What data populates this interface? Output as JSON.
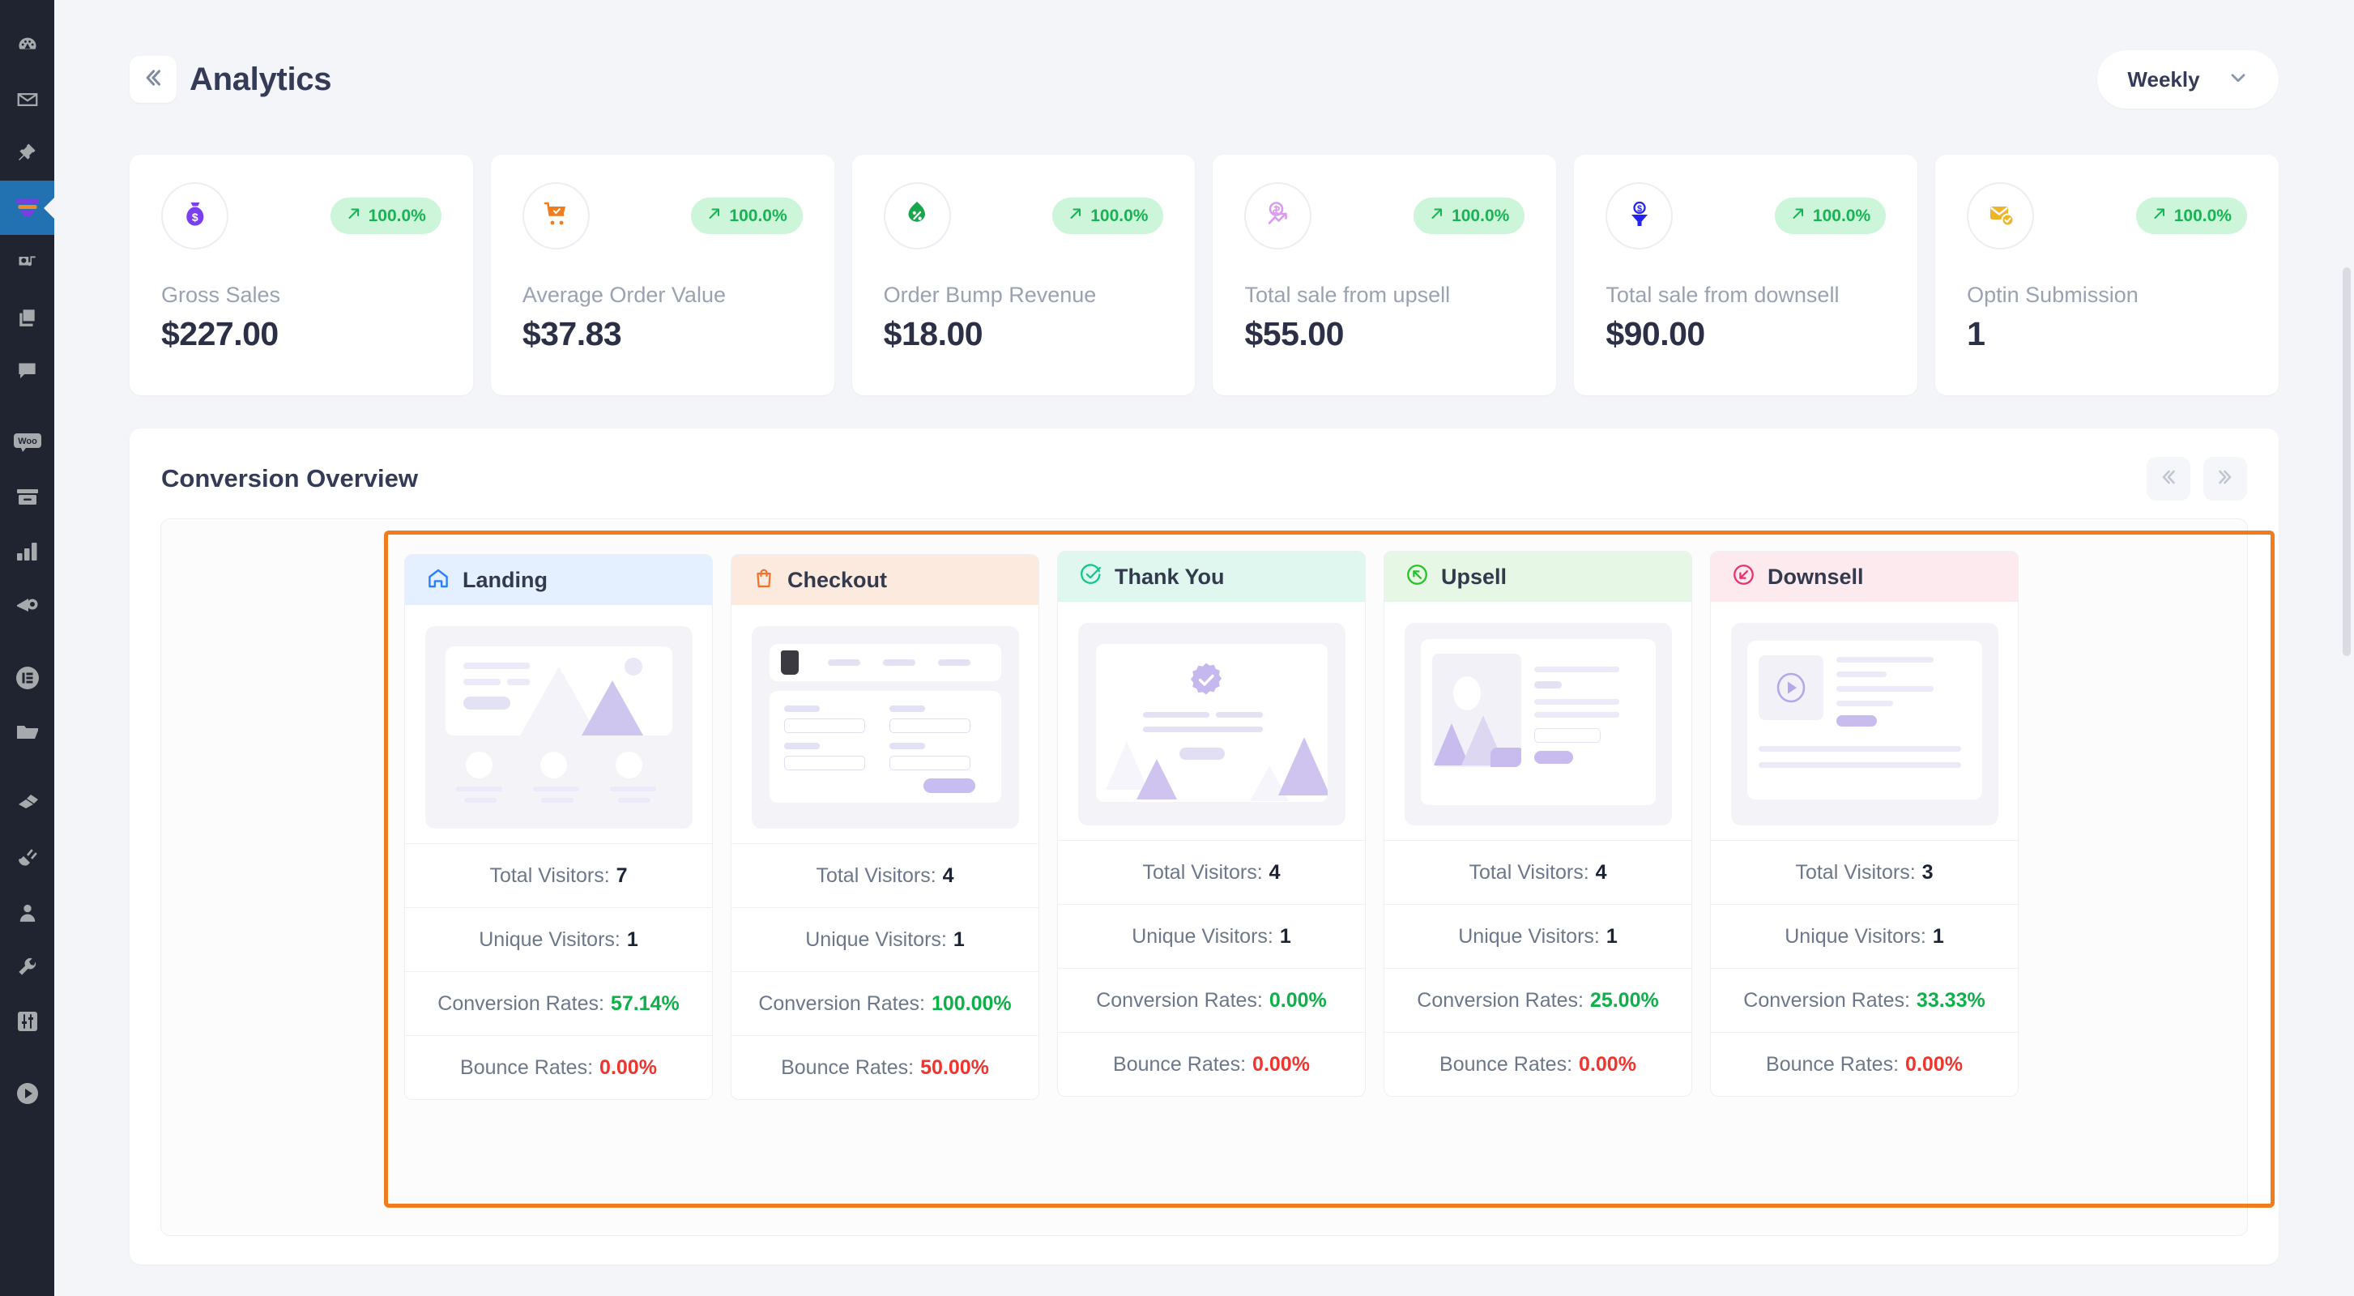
{
  "sidebar": {
    "items": [
      {
        "name": "dashboard",
        "icon": "gauge-icon"
      },
      {
        "name": "mail",
        "icon": "envelope-icon"
      },
      {
        "name": "pin",
        "icon": "pushpin-icon"
      },
      {
        "name": "funnel",
        "icon": "funnel-icon",
        "active": true
      },
      {
        "name": "media",
        "icon": "media-icon"
      },
      {
        "name": "pages",
        "icon": "pages-icon"
      },
      {
        "name": "comments",
        "icon": "comment-icon"
      },
      {
        "name": "woocommerce",
        "icon": "woo-icon"
      },
      {
        "name": "products",
        "icon": "archive-icon"
      },
      {
        "name": "analytics",
        "icon": "bar-chart-icon"
      },
      {
        "name": "marketing",
        "icon": "megaphone-icon"
      },
      {
        "name": "elementor",
        "icon": "elementor-icon"
      },
      {
        "name": "templates",
        "icon": "folder-icon"
      },
      {
        "name": "appearance",
        "icon": "paintbrush-icon"
      },
      {
        "name": "plugins",
        "icon": "plug-icon"
      },
      {
        "name": "users",
        "icon": "user-icon"
      },
      {
        "name": "tools",
        "icon": "wrench-icon"
      },
      {
        "name": "settings",
        "icon": "sliders-icon"
      },
      {
        "name": "player",
        "icon": "play-circle-icon"
      }
    ]
  },
  "header": {
    "title": "Analytics",
    "collapse_icon": "chevron-double-left-icon",
    "period": {
      "label": "Weekly",
      "chevron_icon": "chevron-down-icon"
    }
  },
  "kpis": [
    {
      "label": "Gross Sales",
      "value": "$227.00",
      "change": "100.0%",
      "trend_icon": "arrow-up-right-icon",
      "icon": "money-bag-icon",
      "icon_color": "#7b3ff2"
    },
    {
      "label": "Average Order Value",
      "value": "$37.83",
      "change": "100.0%",
      "trend_icon": "arrow-up-right-icon",
      "icon": "shopping-cart-icon",
      "icon_color": "#f07c1d"
    },
    {
      "label": "Order Bump Revenue",
      "value": "$18.00",
      "change": "100.0%",
      "trend_icon": "arrow-up-right-icon",
      "icon": "discount-leaf-icon",
      "icon_color": "#17a74a"
    },
    {
      "label": "Total sale from upsell",
      "value": "$55.00",
      "change": "100.0%",
      "trend_icon": "arrow-up-right-icon",
      "icon": "revenue-growth-icon",
      "icon_color": "#d99af0"
    },
    {
      "label": "Total sale from downsell",
      "value": "$90.00",
      "change": "100.0%",
      "trend_icon": "arrow-up-right-icon",
      "icon": "sales-funnel-icon",
      "icon_color": "#2323f5"
    },
    {
      "label": "Optin Submission",
      "value": "1",
      "change": "100.0%",
      "trend_icon": "arrow-up-right-icon",
      "icon": "mail-check-icon",
      "icon_color": "#f0b429"
    }
  ],
  "conversion": {
    "title": "Conversion Overview",
    "nav": {
      "prev_icon": "chevron-double-left-icon",
      "next_icon": "chevron-double-right-icon"
    },
    "stat_labels": {
      "total": "Total Visitors:",
      "unique": "Unique Visitors:",
      "conversion": "Conversion Rates:",
      "bounce": "Bounce Rates:"
    },
    "steps": [
      {
        "name": "Landing",
        "icon": "home-icon",
        "icon_color": "#2b7fff",
        "header_bg": "#e4efff",
        "thumb": "landing-page-wireframe",
        "total_visitors": "7",
        "unique_visitors": "1",
        "conversion_rate": "57.14%",
        "bounce_rate": "0.00%"
      },
      {
        "name": "Checkout",
        "icon": "shopping-bag-icon",
        "icon_color": "#f4712c",
        "header_bg": "#fdeade",
        "thumb": "checkout-form-wireframe",
        "total_visitors": "4",
        "unique_visitors": "1",
        "conversion_rate": "100.00%",
        "bounce_rate": "50.00%"
      },
      {
        "name": "Thank You",
        "icon": "check-circle-icon",
        "icon_color": "#10c78e",
        "header_bg": "#dff7ef",
        "thumb": "thank-you-wireframe",
        "total_visitors": "4",
        "unique_visitors": "1",
        "conversion_rate": "0.00%",
        "bounce_rate": "0.00%"
      },
      {
        "name": "Upsell",
        "icon": "arrow-up-circle-icon",
        "icon_color": "#22c522",
        "header_bg": "#e6f7e6",
        "thumb": "upsell-offer-wireframe",
        "total_visitors": "4",
        "unique_visitors": "1",
        "conversion_rate": "25.00%",
        "bounce_rate": "0.00%"
      },
      {
        "name": "Downsell",
        "icon": "arrow-down-circle-icon",
        "icon_color": "#e8336d",
        "header_bg": "#fdeaee",
        "thumb": "downsell-video-wireframe",
        "total_visitors": "3",
        "unique_visitors": "1",
        "conversion_rate": "33.33%",
        "bounce_rate": "0.00%"
      }
    ]
  },
  "colors": {
    "accent_orange": "#f07c1d",
    "positive_green": "#0fb04a",
    "negative_red": "#f0342e",
    "badge_bg": "#cdf5d9",
    "title": "#343b56"
  }
}
